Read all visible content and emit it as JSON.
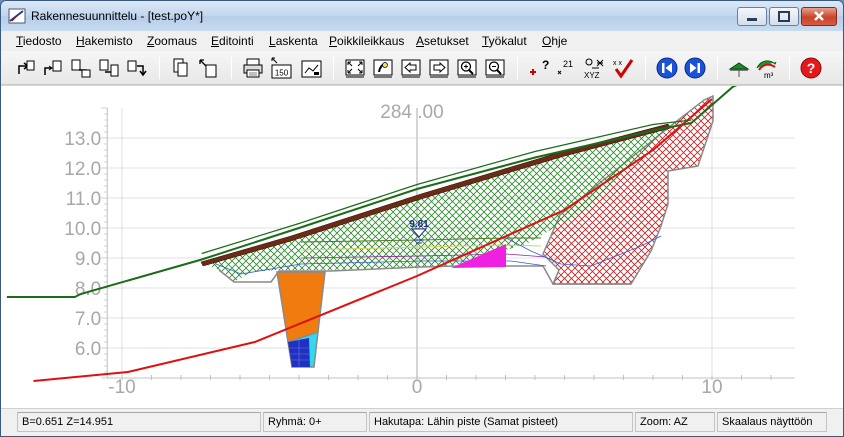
{
  "window": {
    "title": "Rakennesuunnittelu - [test.poY*]"
  },
  "menu": [
    "Tiedosto",
    "Hakemisto",
    "Zoomaus",
    "Editointi",
    "Laskenta",
    "Poikkileikkaus",
    "Asetukset",
    "Työkalut",
    "Ohje"
  ],
  "toolbar": {
    "icons": [
      "undo-icon",
      "open-icon",
      "save-icon",
      "save-as-icon",
      "redo-icon",
      "copy-icon",
      "paste-icon",
      "print-icon",
      "scale-150-icon",
      "print-preview-icon",
      "zoom-fit-icon",
      "zoom-pan-icon",
      "arrow-left-icon",
      "arrow-right-icon",
      "zoom-in-icon",
      "zoom-out-icon",
      "add-point-icon",
      "point-number-icon",
      "coordinates-icon",
      "check-icon",
      "previous-section-icon",
      "next-section-icon",
      "cross-section-icon",
      "volume-icon",
      "help-icon"
    ],
    "scale_label": "150",
    "xyz_label": "XYZ",
    "m3_label": "m³"
  },
  "canvas": {
    "station_label": "284 .00",
    "water_level_label": "9.81",
    "colors": {
      "terrain": "#1a6b1a",
      "subgrade": "#e01010",
      "pavement": "#6b2b14",
      "fill_hatch": "#2a8a2a",
      "cut_hatch": "#c02020",
      "trench": "#f07c10",
      "pipe": "#2030c0",
      "water": "#30d8f0",
      "magenta": "#f020e0"
    }
  },
  "chart_data": {
    "type": "line",
    "title": "",
    "xlabel": "",
    "ylabel": "",
    "xlim": [
      -13.5,
      12.8
    ],
    "ylim": [
      5.0,
      14.0
    ],
    "x_ticks": [
      -10,
      0,
      10
    ],
    "x_tick_labels": [
      "-10",
      "0",
      "10"
    ],
    "y_ticks": [
      6.0,
      7.0,
      8.0,
      9.0,
      10.0,
      11.0,
      12.0,
      13.0
    ],
    "y_tick_labels": [
      "6.0",
      "7.0",
      "8.0",
      "9.0",
      "10.0",
      "11.0",
      "12.0",
      "13.0"
    ],
    "grid": true,
    "series": [
      {
        "x": [
          -13.9,
          -11.6,
          -11.4,
          -7.3,
          -4.0,
          0.0,
          4.0,
          8.0,
          9.3,
          10.7,
          12.7
        ],
        "y": [
          7.7,
          7.7,
          7.8,
          8.95,
          10.0,
          11.3,
          12.35,
          13.25,
          13.5,
          14.7,
          15.6
        ]
      },
      {
        "x": [
          -13.0,
          -9.8,
          -5.5,
          0.0,
          5.0,
          8.0,
          10.0
        ],
        "y": [
          4.9,
          5.2,
          6.2,
          8.4,
          10.6,
          12.6,
          14.3
        ]
      },
      {
        "x": [
          -7.3,
          -4.0,
          0.0,
          4.0,
          8.0,
          9.3
        ],
        "y": [
          9.15,
          10.15,
          11.45,
          12.55,
          13.45,
          13.6
        ]
      }
    ]
  },
  "status": {
    "coords": "B=0.651  Z=14.951",
    "group": "Ryhmä: 0+",
    "search_mode": "Hakutapa: Lähin piste (Samat pisteet)",
    "zoom": "Zoom: AZ",
    "scaling": "Skaalaus näyttöön"
  }
}
